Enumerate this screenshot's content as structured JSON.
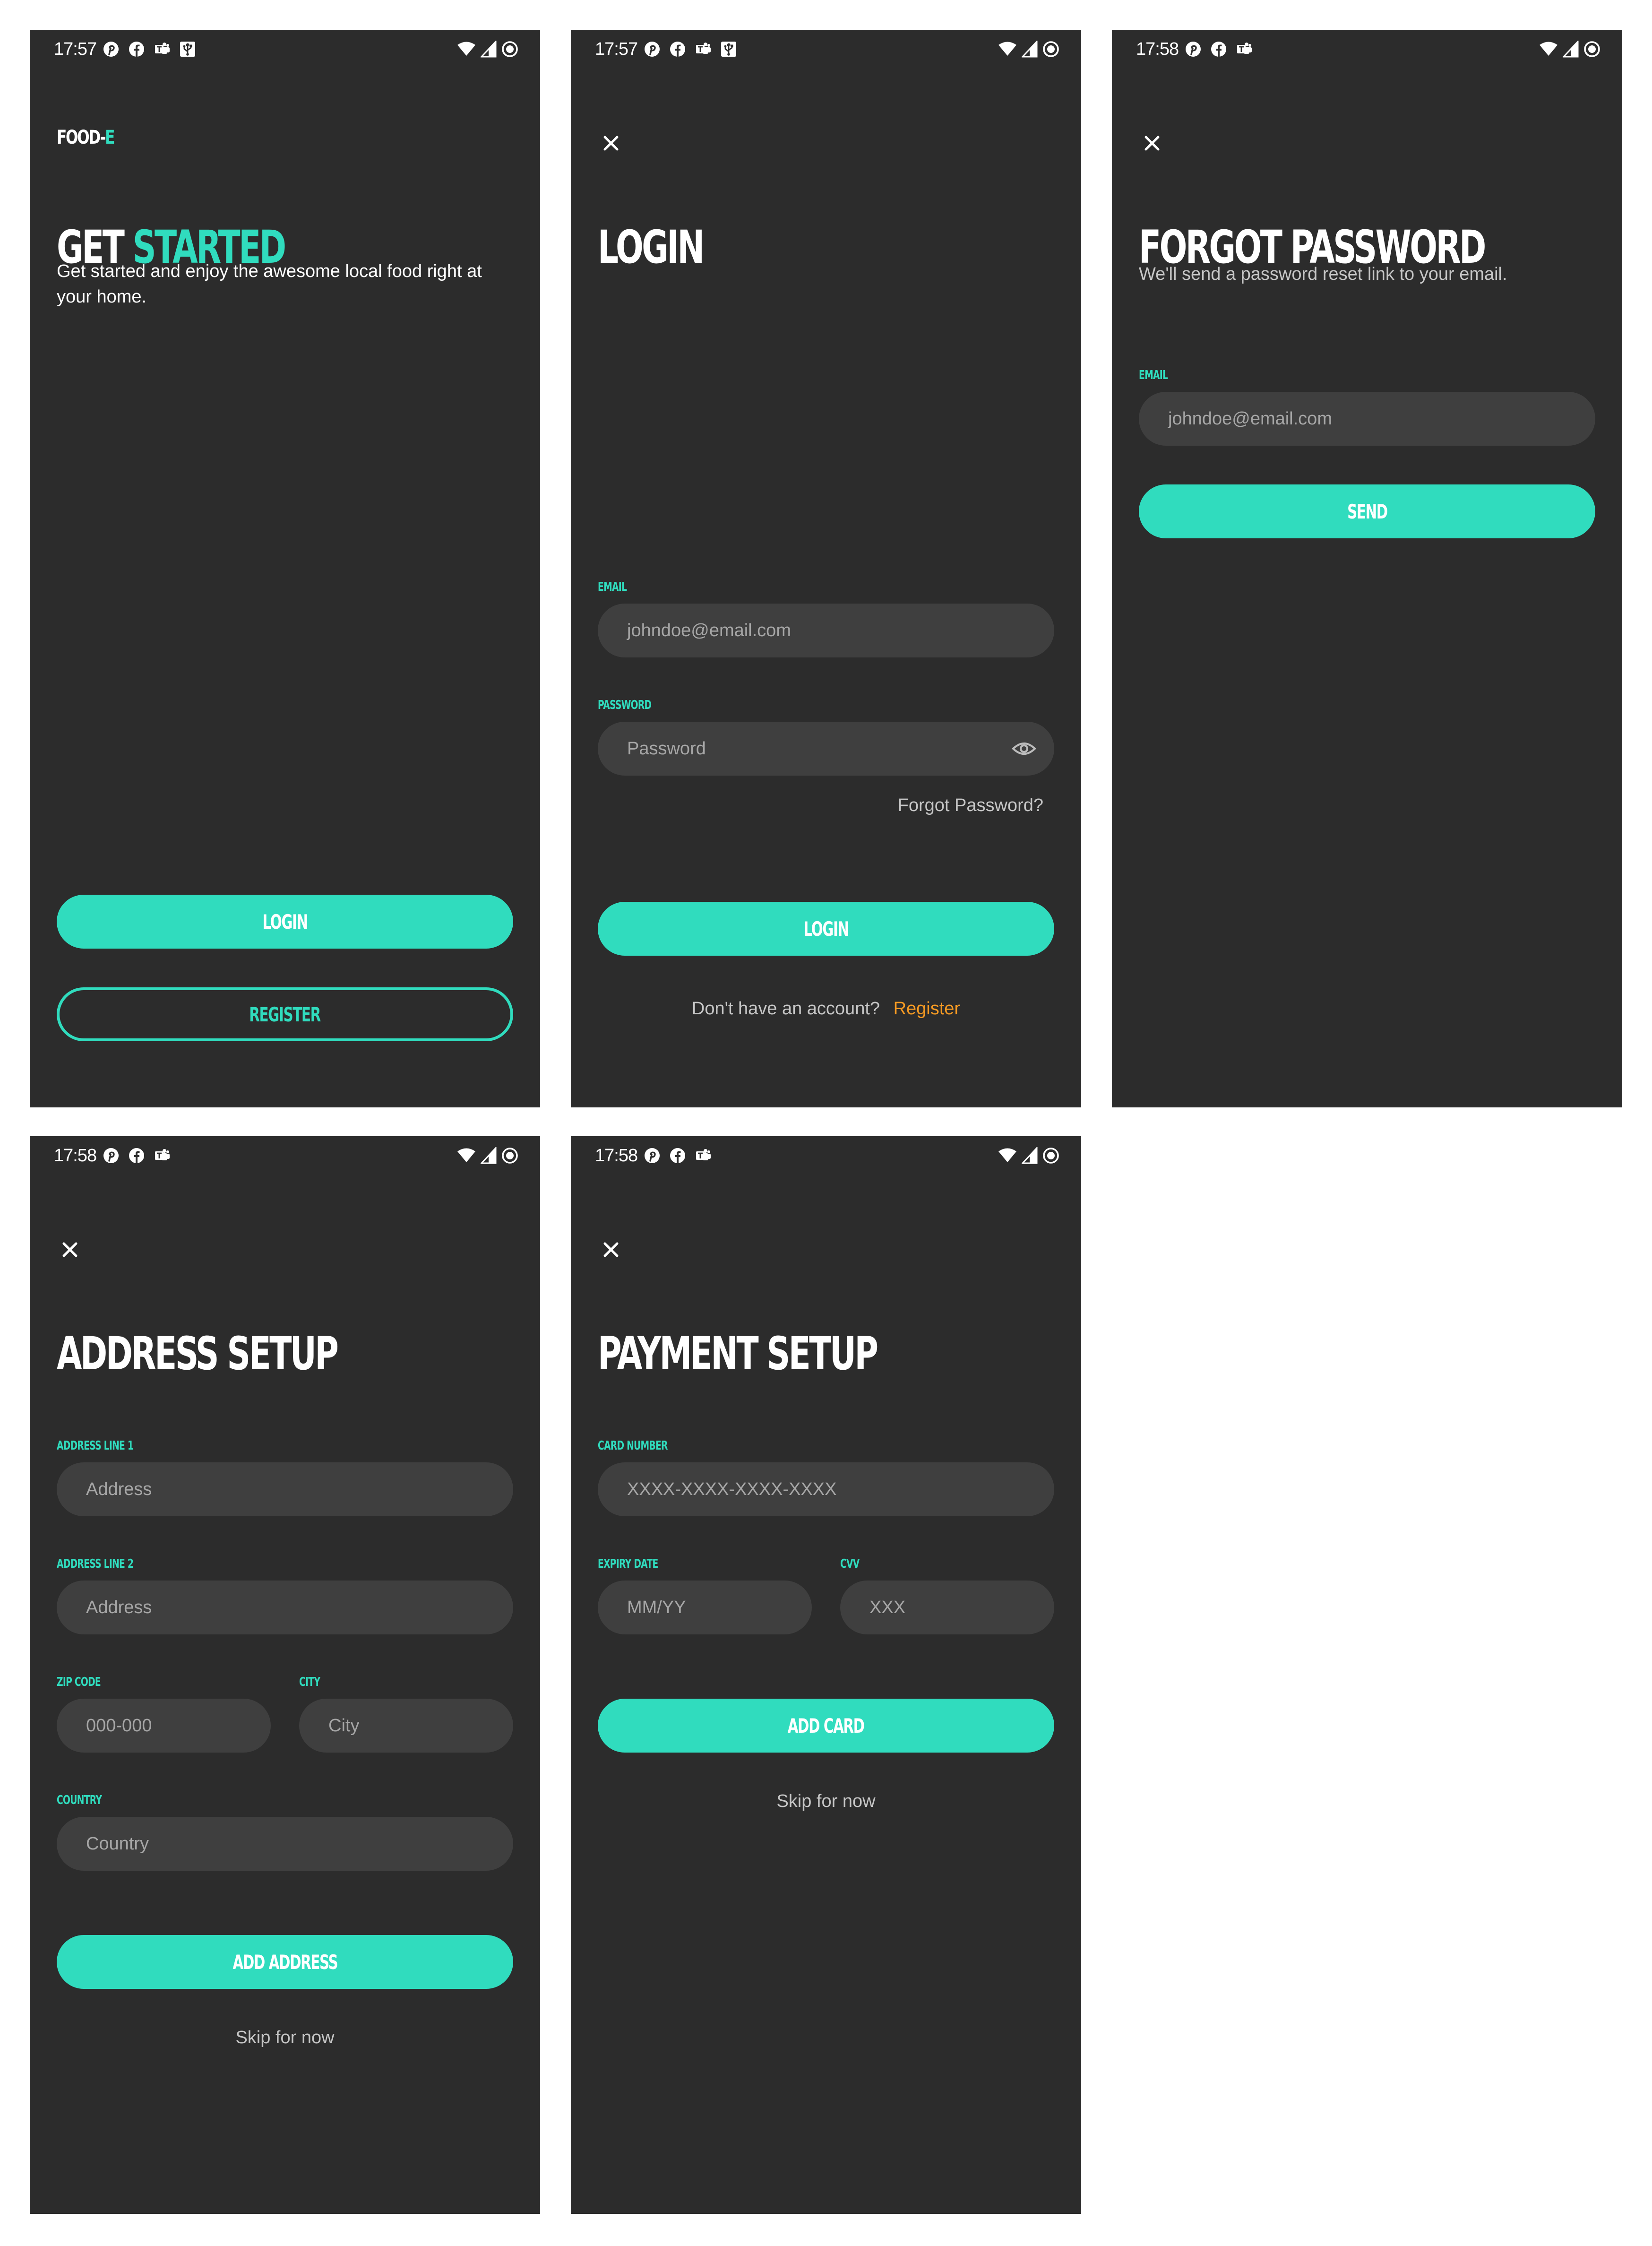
{
  "colors": {
    "accent": "#30dcbe",
    "background": "#2c2c2c",
    "input_bg": "#3f3f3f",
    "link_orange": "#f59a23"
  },
  "screens": {
    "get_started": {
      "status_time": "17:57",
      "brand_main": "FOOD-",
      "brand_accent": "E",
      "title_main": "GET ",
      "title_accent": "STARTED",
      "subtitle": "Get started and enjoy the awesome local food right at your home.",
      "login_label": "LOGIN",
      "register_label": "REGISTER"
    },
    "login": {
      "status_time": "17:57",
      "title": "LOGIN",
      "email_label": "EMAIL",
      "email_placeholder": "johndoe@email.com",
      "password_label": "PASSWORD",
      "password_placeholder": "Password",
      "forgot_link": "Forgot Password?",
      "login_label": "LOGIN",
      "no_account_text": "Don't have an account?",
      "register_link": "Register"
    },
    "forgot_password": {
      "status_time": "17:58",
      "title": "FORGOT PASSWORD",
      "subtitle": "We'll send a password reset link to your email.",
      "email_label": "EMAIL",
      "email_placeholder": "johndoe@email.com",
      "send_label": "SEND"
    },
    "address_setup": {
      "status_time": "17:58",
      "title": "ADDRESS SETUP",
      "line1_label": "ADDRESS LINE 1",
      "line1_placeholder": "Address",
      "line2_label": "ADDRESS LINE 2",
      "line2_placeholder": "Address",
      "zip_label": "ZIP CODE",
      "zip_placeholder": "000-000",
      "city_label": "CITY",
      "city_placeholder": "City",
      "country_label": "COUNTRY",
      "country_placeholder": "Country",
      "add_label": "ADD ADDRESS",
      "skip_label": "Skip for now"
    },
    "payment_setup": {
      "status_time": "17:58",
      "title": "PAYMENT SETUP",
      "card_label": "CARD NUMBER",
      "card_placeholder": "XXXX-XXXX-XXXX-XXXX",
      "expiry_label": "EXPIRY DATE",
      "expiry_placeholder": "MM/YY",
      "cvv_label": "CVV",
      "cvv_placeholder": "XXX",
      "add_label": "ADD CARD",
      "skip_label": "Skip for now"
    }
  },
  "status_icons": {
    "notifications": [
      "pinterest-icon",
      "facebook-icon",
      "teams-icon",
      "usb-icon"
    ],
    "system": [
      "wifi-icon",
      "signal-icon",
      "record-icon"
    ]
  }
}
